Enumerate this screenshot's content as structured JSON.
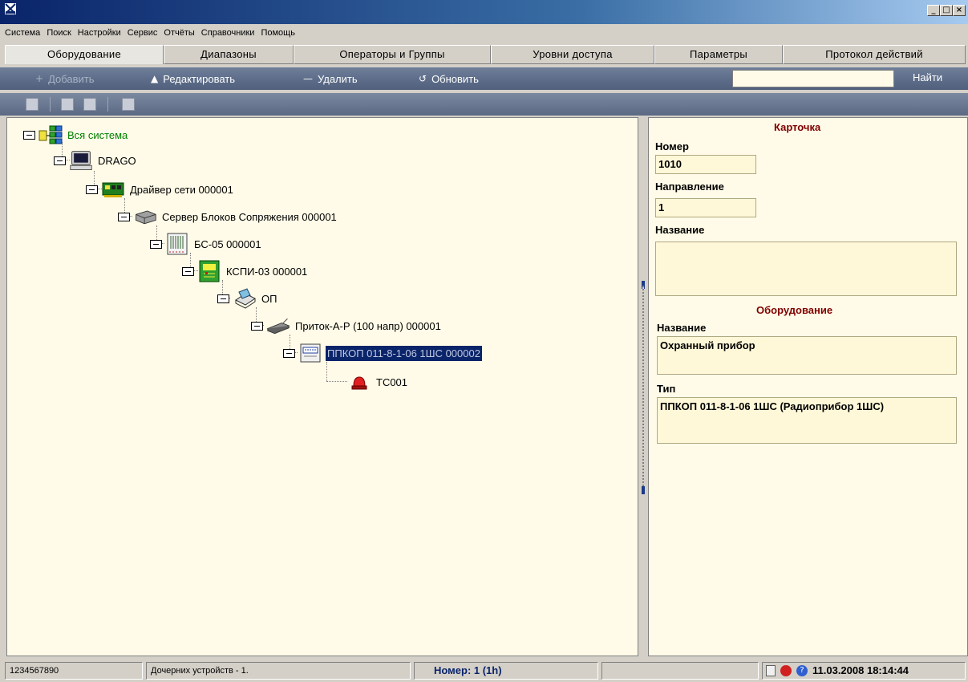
{
  "titlebar": {
    "buttons": [
      "_",
      "□",
      "×"
    ]
  },
  "menu": [
    "Система",
    "Поиск",
    "Настройки",
    "Сервис",
    "Отчёты",
    "Справочники",
    "Помощь"
  ],
  "tabs": [
    "Оборудование",
    "Диапазоны",
    "Операторы и Группы",
    "Уровни доступа",
    "Параметры",
    "Протокол действий"
  ],
  "toolbar": {
    "add_label": "Добавить",
    "edit_label": "Редактировать",
    "delete_label": "Удалить",
    "refresh_label": "Обновить",
    "search_value": "",
    "find_label": "Найти"
  },
  "tree": [
    {
      "label": "Вся система",
      "icon": "network-tree-icon",
      "color": "#008000"
    },
    {
      "label": "DRAGO",
      "icon": "computer-icon"
    },
    {
      "label": "Драйвер сети 000001",
      "icon": "network-card-icon"
    },
    {
      "label": "Сервер Блоков Сопряжения 000001",
      "icon": "server-device-icon"
    },
    {
      "label": "БС-05 000001",
      "icon": "interface-block-icon"
    },
    {
      "label": "КСПИ-03 000001",
      "icon": "circuit-board-icon"
    },
    {
      "label": "ОП",
      "icon": "operator-station-icon"
    },
    {
      "label": "Приток-А-Р (100 напр) 000001",
      "icon": "radio-receiver-icon"
    },
    {
      "label": "ППКОП 011-8-1-06 1ШС 000002",
      "icon": "control-panel-icon",
      "selected": true
    },
    {
      "label": "ТС001",
      "icon": "red-siren-icon"
    }
  ],
  "card": {
    "title": "Карточка",
    "number_label": "Номер",
    "number_value": "1010",
    "direction_label": "Направление",
    "direction_value": "1",
    "name_label": "Название",
    "name_value": "",
    "equipment_title": "Оборудование",
    "eq_name_label": "Название",
    "eq_name_value": "Охранный прибор",
    "eq_type_label": "Тип",
    "eq_type_value": "ППКОП 011-8-1-06 1ШС (Радиоприбор 1ШС)"
  },
  "status": {
    "serial": "1234567890",
    "children": "Дочерних устройств - 1.",
    "number": "Номер: 1 (1h)",
    "datetime": "11.03.2008 18:14:44"
  },
  "colors": {
    "accent": "#0a246a",
    "card_title": "#800000",
    "panel_bg": "#fffbe8"
  }
}
